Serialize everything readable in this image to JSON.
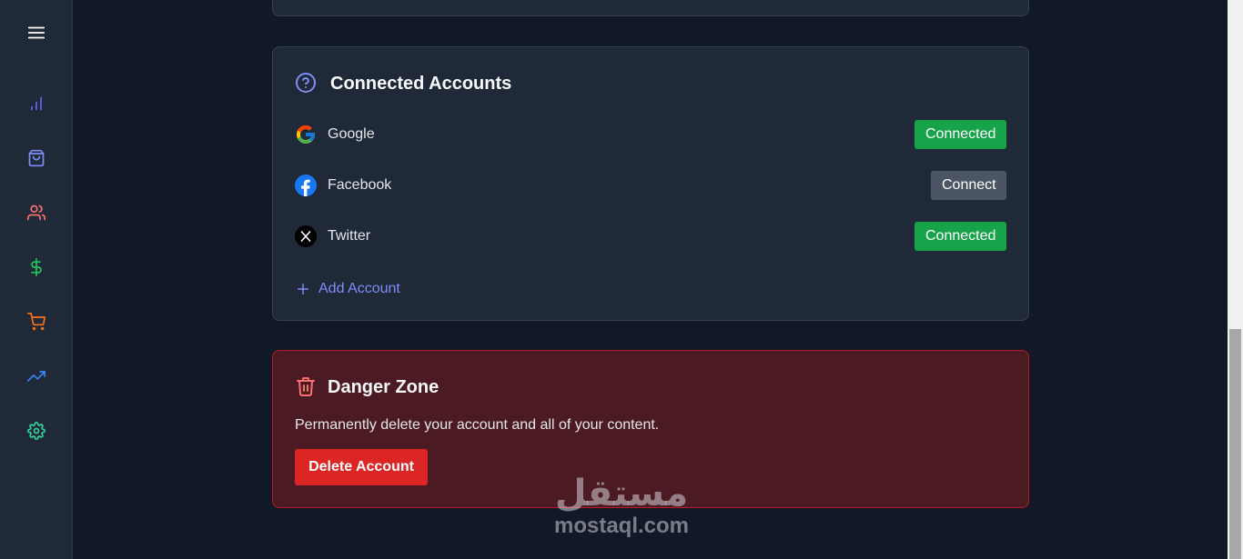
{
  "sidebar": {
    "items": [
      {
        "icon": "menu-icon",
        "color": "#ffffff"
      },
      {
        "icon": "bar-chart-icon",
        "color": "#6366f1"
      },
      {
        "icon": "shopping-bag-icon",
        "color": "#818cf8"
      },
      {
        "icon": "users-icon",
        "color": "#f87171"
      },
      {
        "icon": "dollar-icon",
        "color": "#22c55e"
      },
      {
        "icon": "shopping-cart-icon",
        "color": "#f97316"
      },
      {
        "icon": "trending-up-icon",
        "color": "#3b82f6"
      },
      {
        "icon": "settings-icon",
        "color": "#34d399"
      }
    ]
  },
  "connected_accounts": {
    "title": "Connected Accounts",
    "icon": "help-circle-icon",
    "icon_color": "#818cf8",
    "accounts": [
      {
        "name": "Google",
        "icon": "google-icon",
        "status": "Connected"
      },
      {
        "name": "Facebook",
        "icon": "facebook-icon",
        "status": "Connect"
      },
      {
        "name": "Twitter",
        "icon": "x-twitter-icon",
        "status": "Connected"
      }
    ],
    "add_label": "Add Account"
  },
  "danger_zone": {
    "title": "Danger Zone",
    "icon": "trash-icon",
    "icon_color": "#f87171",
    "description": "Permanently delete your account and all of your content.",
    "delete_label": "Delete Account"
  },
  "watermark": {
    "arabic": "مستقل",
    "latin": "mostaql.com"
  },
  "colors": {
    "background": "#111827",
    "card": "#1f2937",
    "success": "#16a34a",
    "neutral": "#4b5563",
    "danger": "#dc2626",
    "danger_bg": "#4c1a22",
    "accent": "#818cf8"
  }
}
